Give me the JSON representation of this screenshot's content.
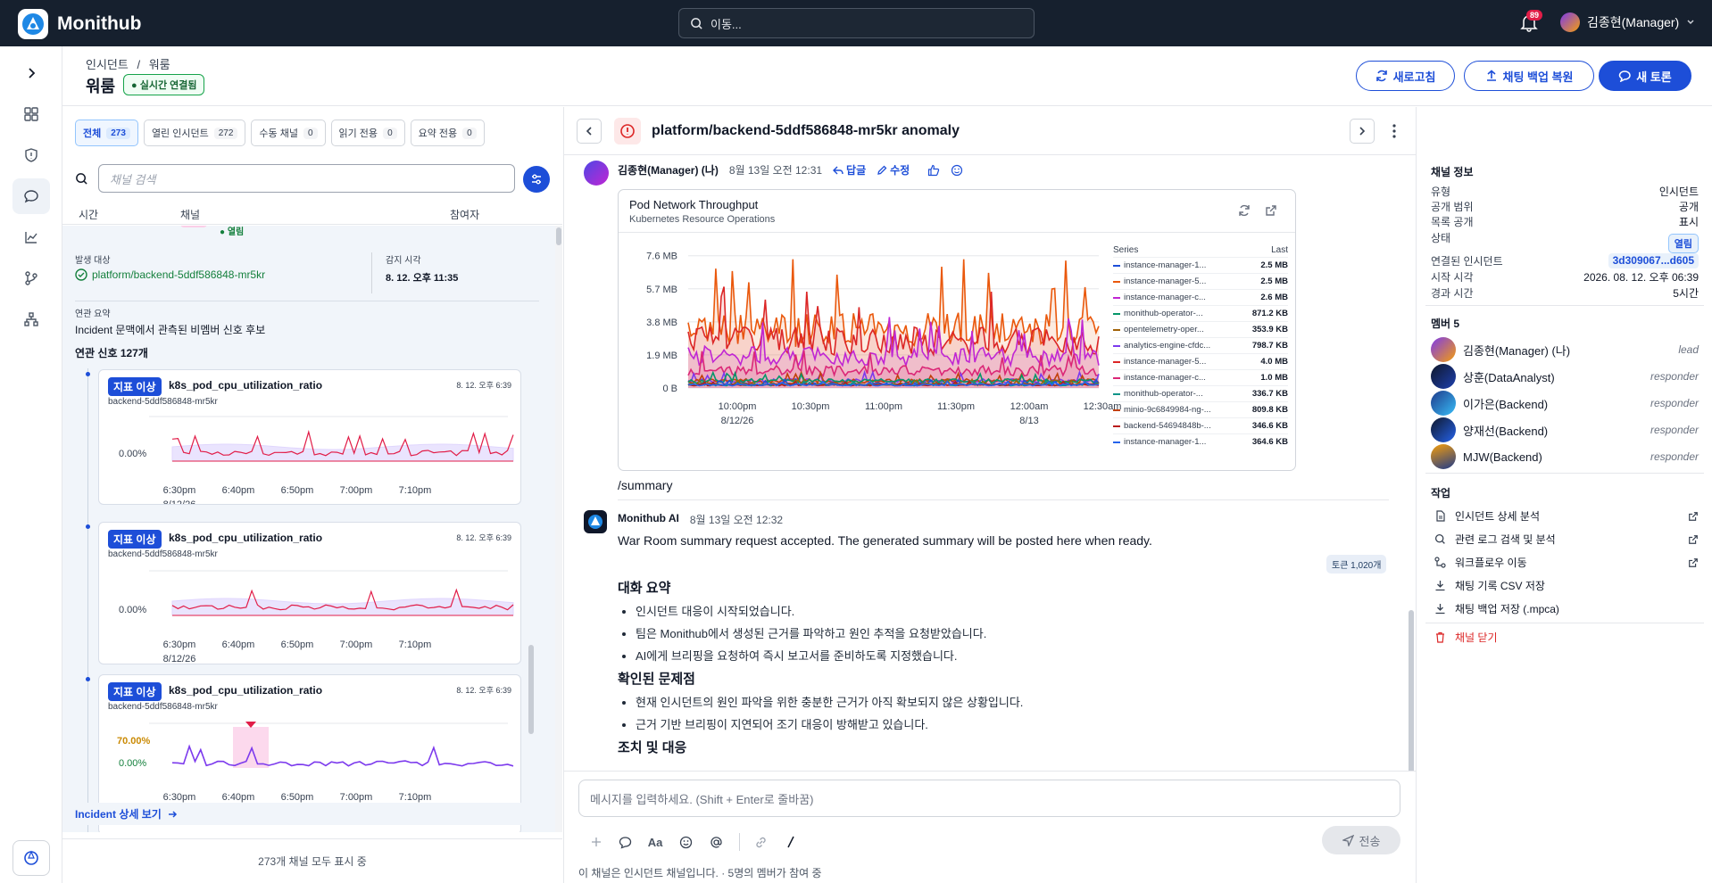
{
  "app": {
    "name": "Monithub"
  },
  "top": {
    "search_placeholder": "이동...",
    "notifications": "89",
    "user": "김종현(Manager)"
  },
  "header": {
    "breadcrumb": [
      "인시던트",
      "/",
      "워룸"
    ],
    "title": "워룸",
    "live_badge": "실시간 연결됨",
    "refresh": "새로고침",
    "restore": "채팅 백업 복원",
    "new_talk": "새 토론"
  },
  "channels": {
    "tabs": [
      {
        "label": "전체",
        "count": "273"
      },
      {
        "label": "열린 인시던트",
        "count": "272"
      },
      {
        "label": "수동 채널",
        "count": "0"
      },
      {
        "label": "읽기 전용",
        "count": "0"
      },
      {
        "label": "요약 전용",
        "count": "0"
      }
    ],
    "search_placeholder": "채널 검색",
    "columns": [
      "시간",
      "채널",
      "참여자"
    ],
    "status_open": "열림",
    "target_label": "발생 대상",
    "target_value": "platform/backend-5ddf586848-mr5kr",
    "detect_label": "감지 시각",
    "detect_value": "8. 12. 오후 11:35",
    "summary_label": "연관 요약",
    "summary_value": "Incident 문맥에서 관측된 비멤버 신호 후보",
    "signals_title": "연관 신호 127개",
    "signals": [
      {
        "tag": "지표 이상",
        "name": "k8s_pod_cpu_utilization_ratio",
        "sub": "backend-5ddf586848-mr5kr",
        "time": "8. 12. 오후 6:39",
        "ytick": "0.00%"
      },
      {
        "tag": "지표 이상",
        "name": "k8s_pod_cpu_utilization_ratio",
        "sub": "backend-5ddf586848-mr5kr",
        "time": "8. 12. 오후 6:39",
        "ytick": "0.00%"
      },
      {
        "tag": "지표 이상",
        "name": "k8s_pod_cpu_utilization_ratio",
        "sub": "backend-5ddf586848-mr5kr",
        "time": "8. 12. 오후 6:39",
        "ytick": "0.00%",
        "ytick2": "70.00%"
      }
    ],
    "mini_xticks": [
      "6:30pm",
      "6:40pm",
      "6:50pm",
      "7:00pm",
      "7:10pm"
    ],
    "mini_date": "8/12/26",
    "incident_link": "Incident 상세 보기",
    "footer": "273개 채널 모두 표시 중"
  },
  "main": {
    "channel_title": "platform/backend-5ddf586848-mr5kr anomaly",
    "msg1": {
      "author": "김종현(Manager) (나)",
      "time": "8월 13일 오전 12:31",
      "reply": "답글",
      "edit": "수정",
      "text": "/summary"
    },
    "chart": {
      "title": "Pod Network Throughput",
      "subtitle": "Kubernetes Resource Operations",
      "legend_head_series": "Series",
      "legend_head_last": "Last"
    },
    "msg2": {
      "author": "Monithub AI",
      "time": "8월 13일 오전 12:32",
      "text": "War Room summary request accepted. The generated summary will be posted here when ready.",
      "token_badge": "토큰 1,020개",
      "sections": [
        {
          "title": "대화 요약",
          "items": [
            "인시던트 대응이 시작되었습니다.",
            "팀은 Monithub에서 생성된 근거를 파악하고 원인 추적을 요청받았습니다.",
            "AI에게 브리핑을 요청하여 즉시 보고서를 준비하도록 지정했습니다."
          ]
        },
        {
          "title": "확인된 문제점",
          "items": [
            "현재 인시던트의 원인 파악을 위한 충분한 근거가 아직 확보되지 않은 상황입니다.",
            "근거 기반 브리핑이 지연되어 조기 대응이 방해받고 있습니다."
          ]
        },
        {
          "title": "조치 및 대응",
          "items": []
        }
      ]
    },
    "composer_placeholder": "메시지를 입력하세요. (Shift + Enter로 줄바꿈)",
    "send": "전송",
    "footnote": "이 채널은 인시던트 채널입니다. · 5명의 멤버가 참여 중"
  },
  "chart_data": {
    "type": "line",
    "title": "Pod Network Throughput",
    "subtitle": "Kubernetes Resource Operations",
    "yticks": [
      "7.6 MB",
      "5.7 MB",
      "3.8 MB",
      "1.9 MB",
      "0 B"
    ],
    "ylim": [
      0,
      8.2
    ],
    "xticks": [
      "10:00pm",
      "10:30pm",
      "11:00pm",
      "11:30pm",
      "12:00am",
      "12:30am"
    ],
    "xtick_dates": [
      "8/12/26",
      "",
      "",
      "",
      "8/13",
      ""
    ],
    "xlim": [
      "9:40pm",
      "12:34am"
    ],
    "grid": true,
    "legend_placement": "right",
    "series": [
      {
        "name": "instance-manager-1...",
        "last": "2.5 MB",
        "color": "#1d4ed8",
        "peak_mb": 0.5
      },
      {
        "name": "instance-manager-5...",
        "last": "2.5 MB",
        "color": "#ea580c",
        "peak_mb": 7.4
      },
      {
        "name": "instance-manager-c...",
        "last": "2.6 MB",
        "color": "#c026d3",
        "peak_mb": 4.1
      },
      {
        "name": "monithub-operator-...",
        "last": "871.2 KB",
        "color": "#059669",
        "peak_mb": 0.9
      },
      {
        "name": "opentelemetry-oper...",
        "last": "353.9 KB",
        "color": "#a16207",
        "peak_mb": 0.5
      },
      {
        "name": "analytics-engine-cfdc...",
        "last": "798.7 KB",
        "color": "#7c3aed",
        "peak_mb": 0.9
      },
      {
        "name": "instance-manager-5...",
        "last": "4.0 MB",
        "color": "#dc2626",
        "peak_mb": 6.0
      },
      {
        "name": "instance-manager-c...",
        "last": "1.0 MB",
        "color": "#db2777",
        "peak_mb": 2.2
      },
      {
        "name": "monithub-operator-...",
        "last": "336.7 KB",
        "color": "#0d9488",
        "peak_mb": 0.4
      },
      {
        "name": "minio-9c6849984-ng-...",
        "last": "809.8 KB",
        "color": "#c2410c",
        "peak_mb": 0.9
      },
      {
        "name": "backend-54694848b-...",
        "last": "346.6 KB",
        "color": "#b91c1c",
        "peak_mb": 0.4
      },
      {
        "name": "instance-manager-1...",
        "last": "364.6 KB",
        "color": "#2563eb",
        "peak_mb": 0.4
      }
    ]
  },
  "info": {
    "channel_info_title": "채널 정보",
    "rows": [
      {
        "k": "유형",
        "v": "인시던트"
      },
      {
        "k": "공개 범위",
        "v": "공개"
      },
      {
        "k": "목록 공개",
        "v": "표시"
      },
      {
        "k": "상태",
        "v": "열림"
      },
      {
        "k": "연결된 인시던트",
        "v": "3d309067...d605"
      },
      {
        "k": "시작 시각",
        "v": "2026. 08. 12. 오후 06:39"
      },
      {
        "k": "경과 시간",
        "v": "5시간"
      }
    ],
    "members_title": "멤버 5",
    "members": [
      {
        "name": "김종현(Manager) (나)",
        "role": "lead",
        "color": "linear-gradient(135deg,#7c3aed,#f59e0b)"
      },
      {
        "name": "상훈(DataAnalyst)",
        "role": "responder",
        "color": "linear-gradient(135deg,#0f172a,#1e40af)"
      },
      {
        "name": "이가은(Backend)",
        "role": "responder",
        "color": "linear-gradient(135deg,#1e3a8a,#38bdf8)"
      },
      {
        "name": "양재선(Backend)",
        "role": "responder",
        "color": "linear-gradient(135deg,#0f172a,#2563eb)"
      },
      {
        "name": "MJW(Backend)",
        "role": "responder",
        "color": "linear-gradient(160deg,#f59e0b,#1e3a8a)"
      }
    ],
    "actions_title": "작업",
    "actions": [
      "인시던트 상세 분석",
      "관련 로그 검색 및 분석",
      "워크플로우 이동",
      "채팅 기록 CSV 저장",
      "채팅 백업 저장 (.mpca)"
    ],
    "close_channel": "채널 닫기"
  },
  "colors": {
    "brand": "#1d4ed8",
    "topbar": "#16202e",
    "danger": "#dc2626"
  }
}
